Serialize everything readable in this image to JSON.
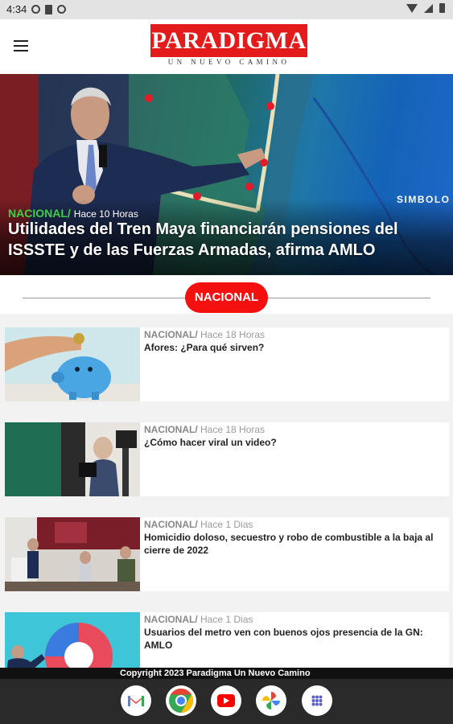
{
  "status_bar": {
    "time": "4:34",
    "left_icons": [
      "settings-icon",
      "sd-card-icon",
      "settings-icon"
    ],
    "right_icons": [
      "wifi-icon",
      "signal-icon",
      "battery-icon"
    ]
  },
  "header": {
    "menu_icon": "hamburger-menu-icon",
    "logo_text": "PARADIGMA",
    "logo_tagline": "UN NUEVO CAMINO",
    "brand_color": "#e31b1b"
  },
  "hero": {
    "category": "NACIONAL/",
    "time": "Hace 10 Horas",
    "title": "Utilidades del Tren Maya financiarán pensiones del ISSSTE y de las Fuerzas Armadas, afirma AMLO",
    "map_label": "SIMBOLO",
    "category_color": "#3fcf47"
  },
  "section": {
    "label": "NACIONAL",
    "pill_color": "#f4100f"
  },
  "articles": [
    {
      "category": "NACIONAL/",
      "time": "Hace 18 Horas",
      "title": "Afores: ¿Para qué sirven?"
    },
    {
      "category": "NACIONAL/",
      "time": "Hace 18 Horas",
      "title": "¿Cómo hacer viral un video?"
    },
    {
      "category": "NACIONAL/",
      "time": "Hace 1 Dias",
      "title": "Homicidio doloso, secuestro y robo de combustible a la baja al cierre de 2022"
    },
    {
      "category": "NACIONAL/",
      "time": "Hace 1 Dias",
      "title": "Usuarios del metro ven con buenos ojos presencia de la GN: AMLO"
    }
  ],
  "footer": {
    "copyright": "Copyright 2023 Paradigma Un Nuevo Camino"
  },
  "dock": {
    "apps": [
      "gmail-icon",
      "chrome-icon",
      "youtube-icon",
      "photos-icon",
      "app-drawer-icon"
    ]
  }
}
